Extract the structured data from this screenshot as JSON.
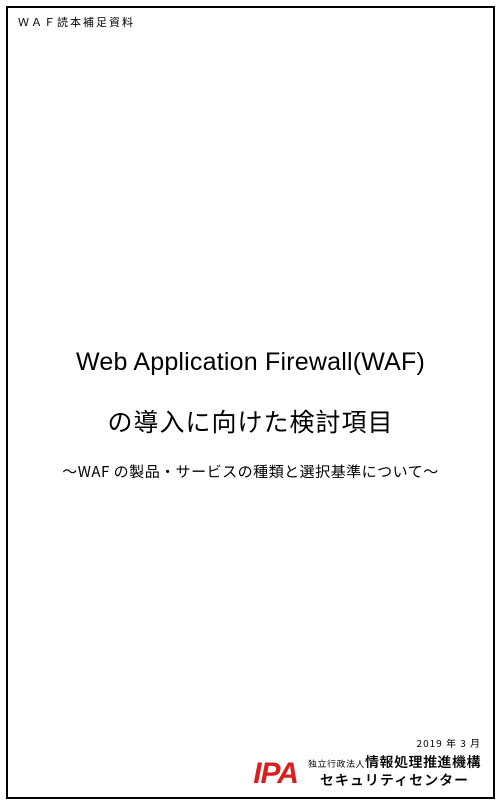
{
  "header": {
    "note": "ＷＡＦ読本補足資料"
  },
  "title": {
    "line1": "Web Application Firewall(WAF)",
    "line2": "の導入に向けた検討項目",
    "subtitle": "～WAF の製品・サービスの種類と選択基準について～"
  },
  "footer": {
    "date": "2019 年 3 月",
    "logo_text": "IPA",
    "org_prefix": "独立行政法人",
    "org_name": "情報処理推進機構",
    "org_dept": "セキュリティセンター"
  }
}
